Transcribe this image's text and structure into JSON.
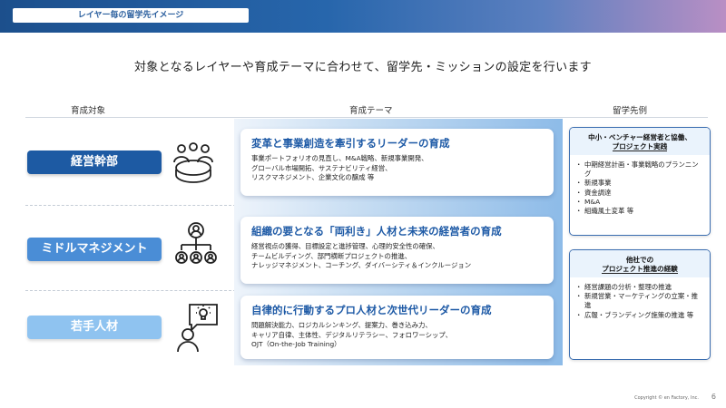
{
  "header": {
    "tag": "レイヤー毎の留学先イメージ",
    "headline": "対象となるレイヤーや育成テーマに合わせて、留学先・ミッションの設定を行います"
  },
  "columns": {
    "target": "育成対象",
    "theme": "育成テーマ",
    "example": "留学先例"
  },
  "rows": [
    {
      "target": "経営幹部",
      "icon": "meeting-table-icon",
      "title": "変革と事業創造を牽引するリーダーの育成",
      "lines": [
        "事業ポートフォリオの見直し、M&A戦略、新規事業開発、",
        "グローバル市場開拓、サステナビリティ経営、",
        "リスクマネジメント、企業文化の醸成 等"
      ]
    },
    {
      "target": "ミドルマネジメント",
      "icon": "org-chart-icon",
      "title": "組織の要となる「両利き」人材と未来の経営者の育成",
      "lines": [
        "経営視点の獲得、目標設定と進捗管理、心理的安全性の確保、",
        "チームビルディング、部門横断プロジェクトの推進、",
        "ナレッジマネジメント、コーチング、ダイバーシティ＆インクルージョン"
      ]
    },
    {
      "target": "若手人材",
      "icon": "idea-person-icon",
      "title": "自律的に行動するプロ人材と次世代リーダーの育成",
      "lines": [
        "問題解決能力、ロジカルシンキング、提案力、巻き込み力、",
        "キャリア自律、主体性、デジタルリテラシー、フォロワーシップ、",
        "OJT（On-the-Job Training）"
      ]
    }
  ],
  "examples": [
    {
      "title_lines": [
        "中小・ベンチャー経営者と協働、",
        "プロジェクト実践"
      ],
      "items": [
        "中期経営計画・事業戦略のプランニング",
        "新規事業",
        "資金調達",
        "M&A",
        "組織風土変革 等"
      ]
    },
    {
      "title_lines": [
        "他社での",
        "プロジェクト推進の経験"
      ],
      "items": [
        "経営課題の分析・整理の推進",
        "新規営業・マーケティングの立案・推進",
        "広報・ブランディング施策の推進 等"
      ]
    }
  ],
  "footer": {
    "copyright": "Copyright © en Factory, Inc.",
    "page": "6"
  },
  "colors": {
    "brand_dark": "#1d5aa3",
    "brand_mid": "#4a8dd6",
    "brand_light": "#8fc3f0",
    "title_blue": "#1e5aa6"
  }
}
